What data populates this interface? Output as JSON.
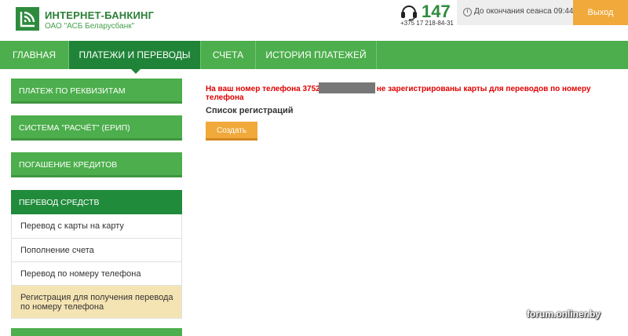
{
  "header": {
    "brand_title": "ИНТЕРНЕТ-БАНКИНГ",
    "brand_subtitle": "ОАО \"АСБ Беларусбанк\"",
    "phone_short": "147",
    "phone_long": "+375 17 218-84-31",
    "session_text": "До окончания сеанса 09:44",
    "logout_label": "Выход"
  },
  "nav": {
    "items": [
      {
        "label": "ГЛАВНАЯ"
      },
      {
        "label": "ПЛАТЕЖИ И ПЕРЕВОДЫ"
      },
      {
        "label": "СЧЕТА"
      },
      {
        "label": "ИСТОРИЯ ПЛАТЕЖЕЙ"
      }
    ],
    "active_index": 1
  },
  "sidebar": {
    "sections": [
      {
        "label": "ПЛАТЕЖ ПО РЕКВИЗИТАМ"
      },
      {
        "label": "СИСТЕМА \"РАСЧЁТ\" (ЕРИП)"
      },
      {
        "label": "ПОГАШЕНИЕ КРЕДИТОВ"
      },
      {
        "label": "ПЕРЕВОД СРЕДСТВ"
      }
    ],
    "subitems": [
      {
        "label": "Перевод с карты на карту"
      },
      {
        "label": "Пополнение счета"
      },
      {
        "label": "Перевод по номеру телефона"
      },
      {
        "label": "Регистрация для получения перевода по номеру телефона"
      }
    ]
  },
  "main": {
    "alert_prefix": "На ваш номер телефона 3752",
    "alert_suffix": "не зарегистрированы карты для переводов по номеру телефона",
    "registrations_title": "Список регистраций",
    "create_label": "Создать"
  },
  "watermark": "forum.onliner.by",
  "colors": {
    "brand_green": "#4cae4c",
    "dark_green": "#208438",
    "accent_orange": "#f0a93a",
    "alert_red": "#e00000",
    "selected_bg": "#f5e4b3"
  },
  "icons": [
    "logo-icon",
    "headset-icon",
    "clock-icon"
  ]
}
